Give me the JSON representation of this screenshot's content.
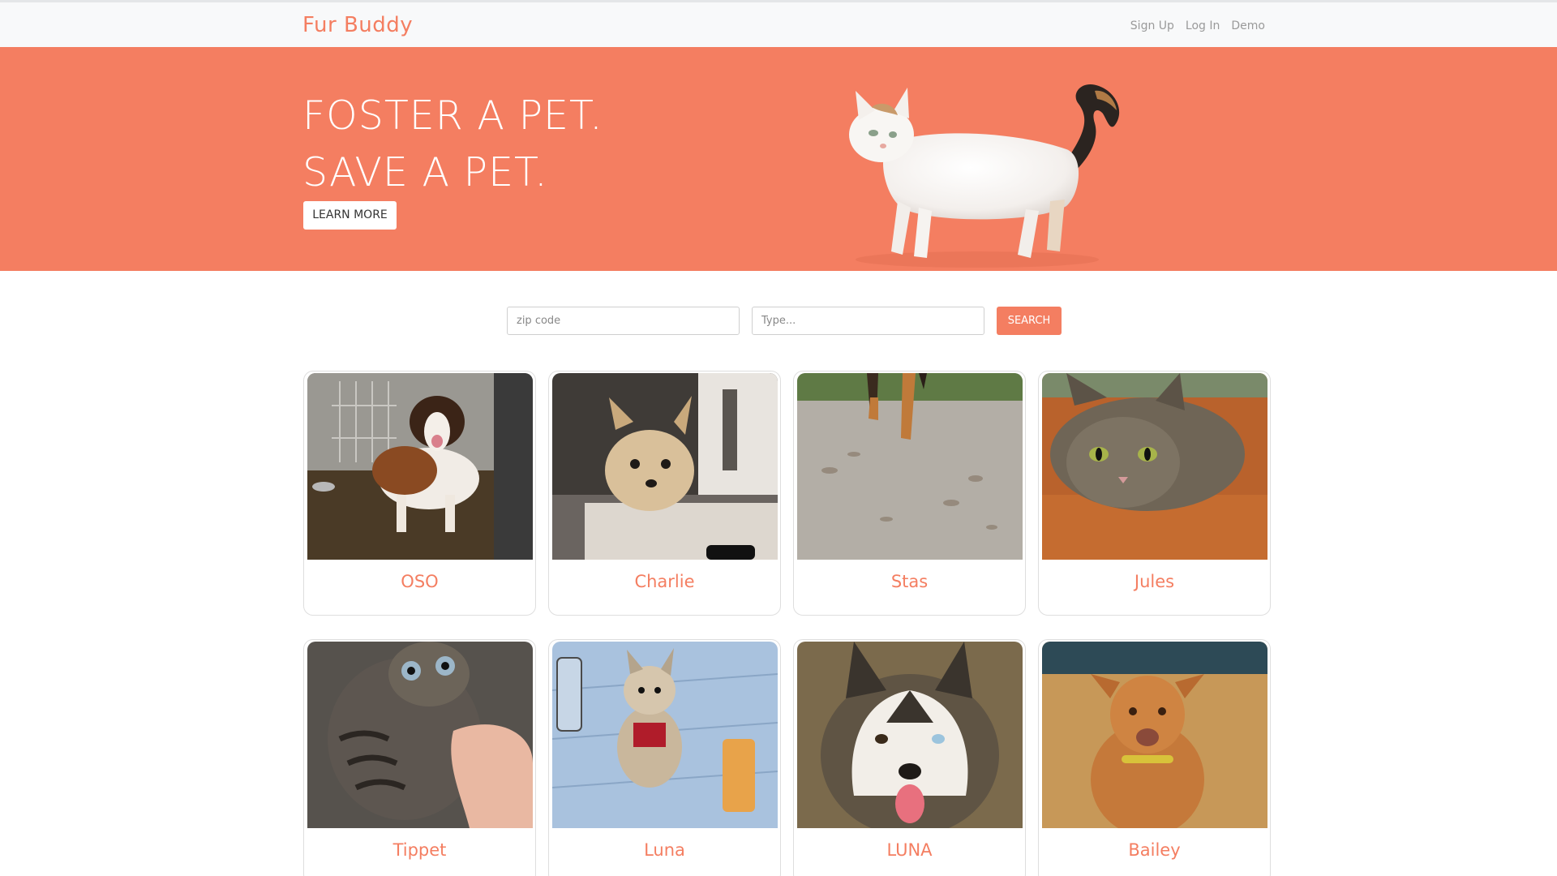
{
  "nav": {
    "brand": "Fur Buddy",
    "links": [
      "Sign Up",
      "Log In",
      "Demo"
    ]
  },
  "hero": {
    "line1": "FOSTER A PET.",
    "line2": "SAVE A PET.",
    "button": "LEARN MORE"
  },
  "search": {
    "zip_placeholder": "zip code",
    "type_placeholder": "Type...",
    "button": "SEARCH"
  },
  "pets": [
    {
      "name": "OSO",
      "image": "st-bernard-in-kennel"
    },
    {
      "name": "Charlie",
      "image": "yorkie-on-counter"
    },
    {
      "name": "Stas",
      "image": "dog-legs-on-pavement"
    },
    {
      "name": "Jules",
      "image": "tabby-cat-on-table"
    },
    {
      "name": "Tippet",
      "image": "tabby-kitten-in-hand"
    },
    {
      "name": "Luna",
      "image": "terrier-on-blanket"
    },
    {
      "name": "LUNA",
      "image": "husky-closeup"
    },
    {
      "name": "Bailey",
      "image": "tan-dog-sitting"
    }
  ],
  "colors": {
    "accent": "#f47e61",
    "nav_bg": "#f8f9fa",
    "link": "#9a9a9a"
  }
}
